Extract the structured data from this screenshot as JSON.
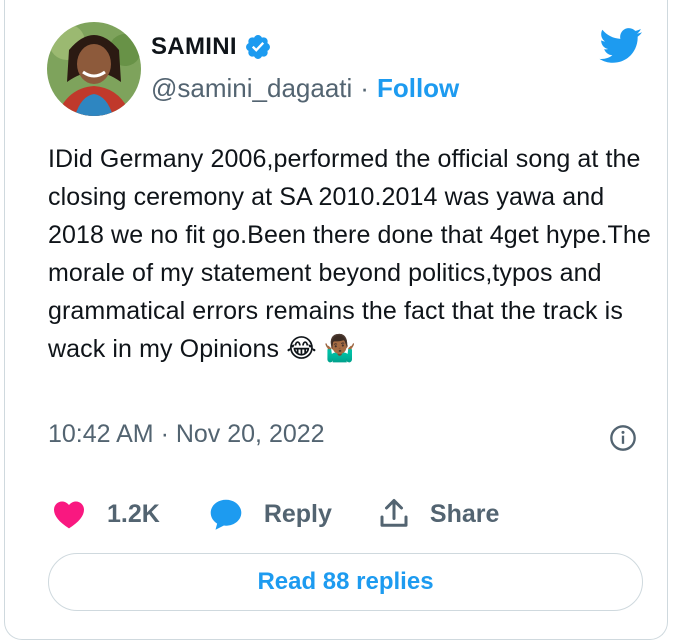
{
  "author": {
    "name": "SAMINI",
    "handle": "@samini_dagaati",
    "separator": "·",
    "follow_label": "Follow",
    "verified": true
  },
  "tweet": {
    "text": "IDid Germany 2006,performed the official song at the closing ceremony at SA 2010.2014 was yawa and 2018 we no fit go.Been there done that 4get hype.The morale of my statement beyond politics,typos and grammatical errors remains the fact that the track is wack in my Opinions",
    "emoji_1": "😂",
    "emoji_2": "🤷🏾‍♂️",
    "timestamp": "10:42 AM · Nov 20, 2022"
  },
  "actions": {
    "like_count": "1.2K",
    "reply_label": "Reply",
    "share_label": "Share"
  },
  "read_replies_label": "Read 88 replies",
  "colors": {
    "accent": "#1d9bf0",
    "like": "#f91880",
    "muted": "#536471",
    "border": "#cfd9de"
  },
  "icons": {
    "brand": "twitter-bird-icon",
    "verified": "verified-badge-icon",
    "info": "info-icon",
    "like": "heart-icon",
    "reply": "speech-bubble-icon",
    "share": "share-upload-icon"
  }
}
